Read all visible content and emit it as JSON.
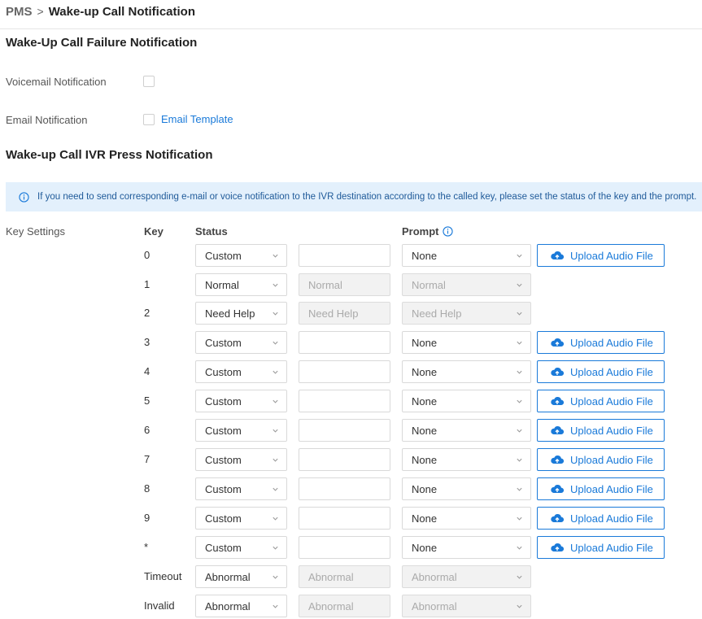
{
  "breadcrumb": {
    "root": "PMS",
    "separator": ">",
    "current": "Wake-up Call Notification"
  },
  "failure_section": {
    "title": "Wake-Up Call Failure Notification",
    "voicemail_label": "Voicemail Notification",
    "email_label": "Email Notification",
    "email_template_link": "Email Template"
  },
  "ivr_section": {
    "title": "Wake-up Call IVR Press Notification",
    "info_text": "If you need to send corresponding e-mail or voice notification to the IVR destination according to the called key, please set the status of the key and the prompt."
  },
  "key_settings": {
    "label": "Key Settings",
    "headers": {
      "key": "Key",
      "status": "Status",
      "prompt": "Prompt"
    },
    "upload_label": "Upload Audio File",
    "rows": [
      {
        "key": "0",
        "status": "Custom",
        "text": "",
        "prompt": "None",
        "editable": true
      },
      {
        "key": "1",
        "status": "Normal",
        "text": "Normal",
        "prompt": "Normal",
        "editable": false
      },
      {
        "key": "2",
        "status": "Need Help",
        "text": "Need Help",
        "prompt": "Need Help",
        "editable": false
      },
      {
        "key": "3",
        "status": "Custom",
        "text": "",
        "prompt": "None",
        "editable": true
      },
      {
        "key": "4",
        "status": "Custom",
        "text": "",
        "prompt": "None",
        "editable": true
      },
      {
        "key": "5",
        "status": "Custom",
        "text": "",
        "prompt": "None",
        "editable": true
      },
      {
        "key": "6",
        "status": "Custom",
        "text": "",
        "prompt": "None",
        "editable": true
      },
      {
        "key": "7",
        "status": "Custom",
        "text": "",
        "prompt": "None",
        "editable": true
      },
      {
        "key": "8",
        "status": "Custom",
        "text": "",
        "prompt": "None",
        "editable": true
      },
      {
        "key": "9",
        "status": "Custom",
        "text": "",
        "prompt": "None",
        "editable": true
      },
      {
        "key": "*",
        "status": "Custom",
        "text": "",
        "prompt": "None",
        "editable": true
      },
      {
        "key": "Timeout",
        "status": "Abnormal",
        "text": "Abnormal",
        "prompt": "Abnormal",
        "editable": false
      },
      {
        "key": "Invalid",
        "status": "Abnormal",
        "text": "Abnormal",
        "prompt": "Abnormal",
        "editable": false
      }
    ]
  },
  "colors": {
    "accent": "#1a7ad9",
    "banner_bg": "#e3f0fc"
  },
  "icons": {
    "info": "info-circle-icon",
    "dropdown": "chevron-down-icon",
    "upload": "cloud-upload-icon"
  }
}
